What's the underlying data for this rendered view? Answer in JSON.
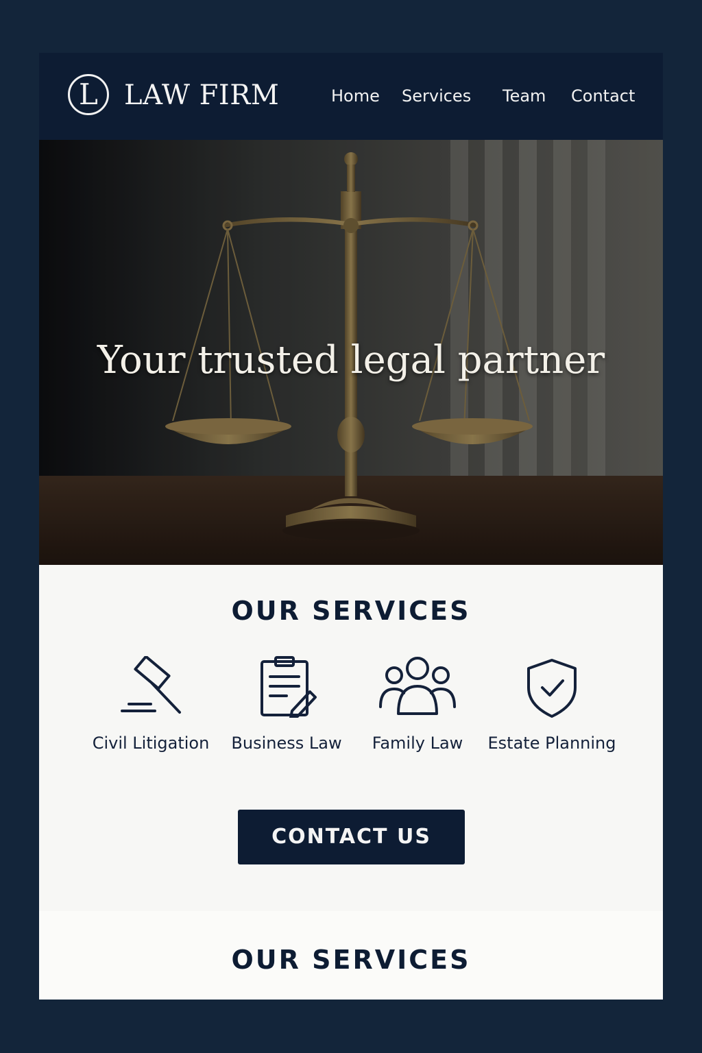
{
  "header": {
    "logo_letter": "L",
    "brand": "LAW FIRM",
    "nav": [
      "Home",
      "Services",
      "Team",
      "Contact"
    ]
  },
  "hero": {
    "title": "Your trusted legal partner"
  },
  "services": {
    "heading": "OUR SERVICES",
    "items": [
      {
        "label": "Civil Litigation",
        "icon": "gavel-icon"
      },
      {
        "label": "Business Law",
        "icon": "clipboard-icon"
      },
      {
        "label": "Family Law",
        "icon": "people-icon"
      },
      {
        "label": "Estate Planning",
        "icon": "shield-check-icon"
      }
    ],
    "cta": "CONTACT US"
  },
  "lower": {
    "heading": "OUR SERVICES"
  },
  "colors": {
    "background": "#13253a",
    "header": "#0d1c33",
    "page": "#f7f7f5",
    "bronze": "#8a7448"
  }
}
